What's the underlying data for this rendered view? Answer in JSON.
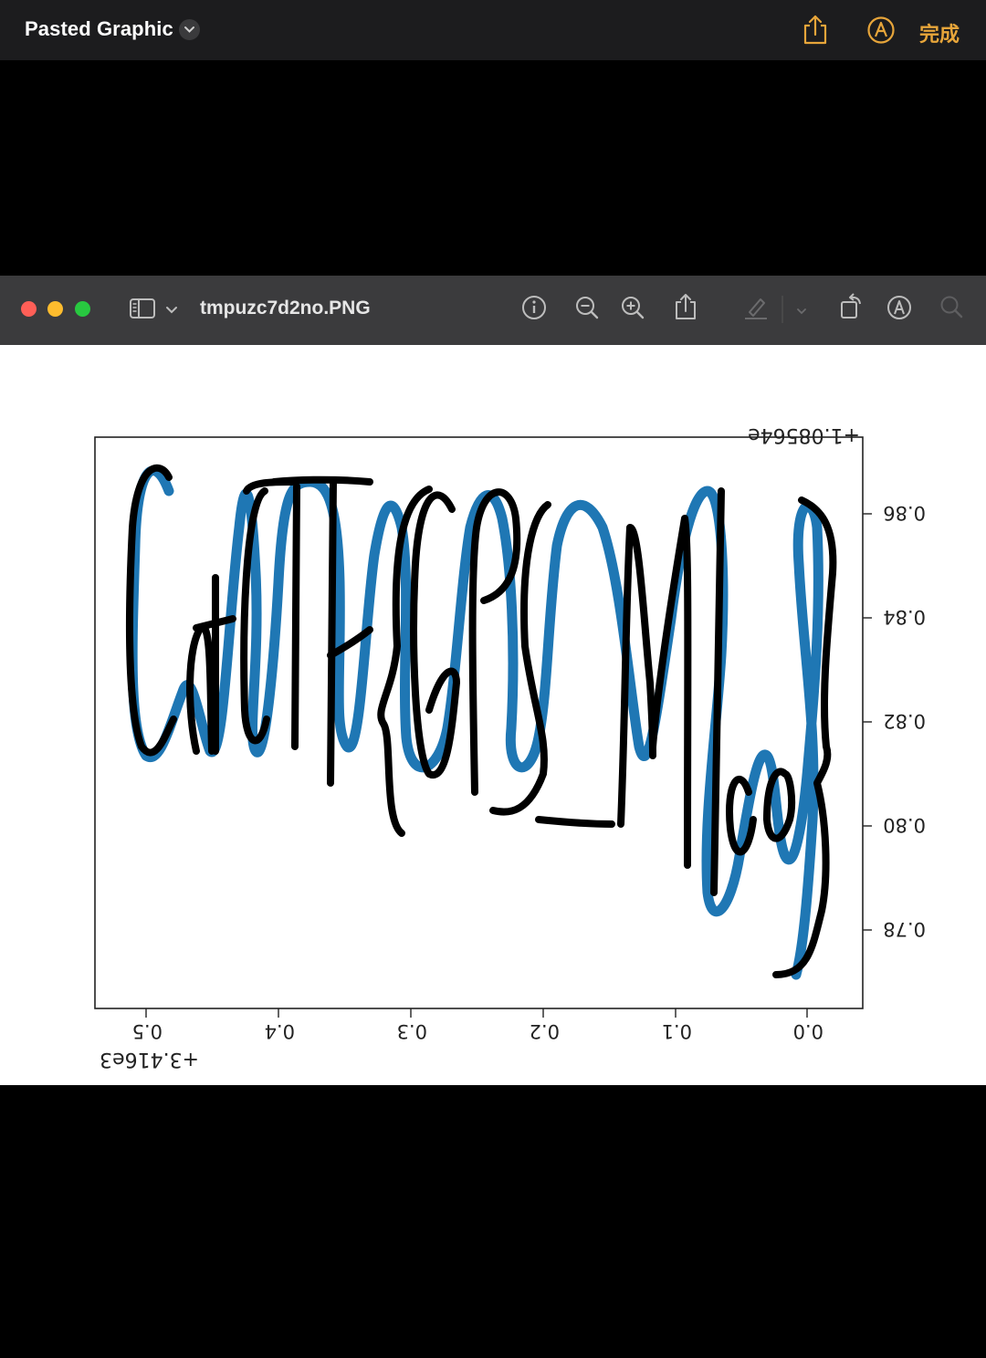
{
  "topbar": {
    "title": "Pasted Graphic",
    "done_label": "完成",
    "accent_color": "#e7a53a"
  },
  "window": {
    "filename": "tmpuzc7d2no.PNG",
    "toolbar_icons": [
      "sidebar-icon",
      "chevron-down-icon",
      "info-icon",
      "zoom-out-icon",
      "zoom-in-icon",
      "share-icon",
      "highlight-pen-icon",
      "chevron-down-icon",
      "rotate-icon",
      "markup-icon",
      "search-icon"
    ]
  },
  "chart_data": {
    "type": "line",
    "note_mirrored": true,
    "x_offset_label": "+3.416e3",
    "y_offset_label": "+1.08564e",
    "x_ticks": [
      "0.5",
      "0.4",
      "0.3",
      "0.2",
      "0.1",
      "0.0"
    ],
    "y_ticks": [
      "0.86",
      "0.84",
      "0.82",
      "0.80",
      "0.78"
    ],
    "series_color": "#1f77b4",
    "overlay_color": "#000000"
  }
}
